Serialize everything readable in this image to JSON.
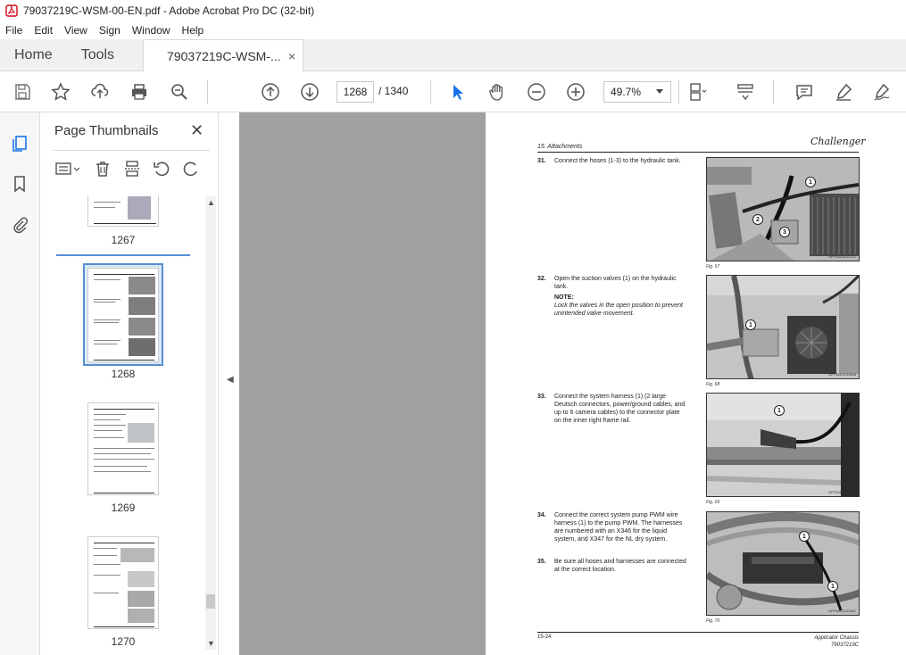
{
  "window": {
    "title": "79037219C-WSM-00-EN.pdf - Adobe Acrobat Pro DC (32-bit)"
  },
  "menu": [
    "File",
    "Edit",
    "View",
    "Sign",
    "Window",
    "Help"
  ],
  "tabs": {
    "home": "Home",
    "tools": "Tools",
    "document": "79037219C-WSM-...",
    "close": "×"
  },
  "toolbar": {
    "current_page": "1268",
    "total_pages": "/ 1340",
    "zoom": "49.7%"
  },
  "panel": {
    "title": "Page Thumbnails",
    "close": "✕",
    "thumbnails": [
      {
        "label": "1267",
        "selected": false
      },
      {
        "label": "1268",
        "selected": true
      },
      {
        "label": "1269",
        "selected": false
      },
      {
        "label": "1270",
        "selected": false
      }
    ]
  },
  "document": {
    "header": "15. Attachments",
    "brand": "Challenger",
    "steps": [
      {
        "num": "31.",
        "text": "Connect the hoses (1-3) to the hydraulic tank.",
        "fig": "Fig. 67",
        "code": "APF3AD1103721"
      },
      {
        "num": "32.",
        "text": "Open the suction valves (1) on the hydraulic tank.",
        "note_label": "NOTE:",
        "note": "Lock the valves in the open position to prevent unintended valve movement.",
        "fig": "Fig. 68",
        "code": "APF3AD1103848"
      },
      {
        "num": "33.",
        "text": "Connect the system harness (1) (2 large Deutsch connectors, power/ground cables, and up to 6 camera cables) to the connector plate on the inner right frame rail.",
        "fig": "Fig. 69",
        "code": "APF3AD1103639"
      },
      {
        "num": "34.",
        "text": "Connect the correct system pump PWM wire harness (1) to the pump PWM. The harnesses are numbered with an X346 for the liquid system, and X347 for the NL dry system.",
        "fig": "Fig. 70",
        "code": "APF3AD1103461"
      },
      {
        "num": "35.",
        "text": "Be sure all hoses and harnesses are connected at the correct location."
      }
    ],
    "callouts": {
      "f67": [
        "1",
        "2",
        "3"
      ],
      "f68": [
        "1"
      ],
      "f69": [
        "1"
      ],
      "f70": [
        "1",
        "1"
      ]
    },
    "footer_left": "15-24",
    "footer_right_1": "Applicator Chassis",
    "footer_right_2": "79037219C"
  }
}
